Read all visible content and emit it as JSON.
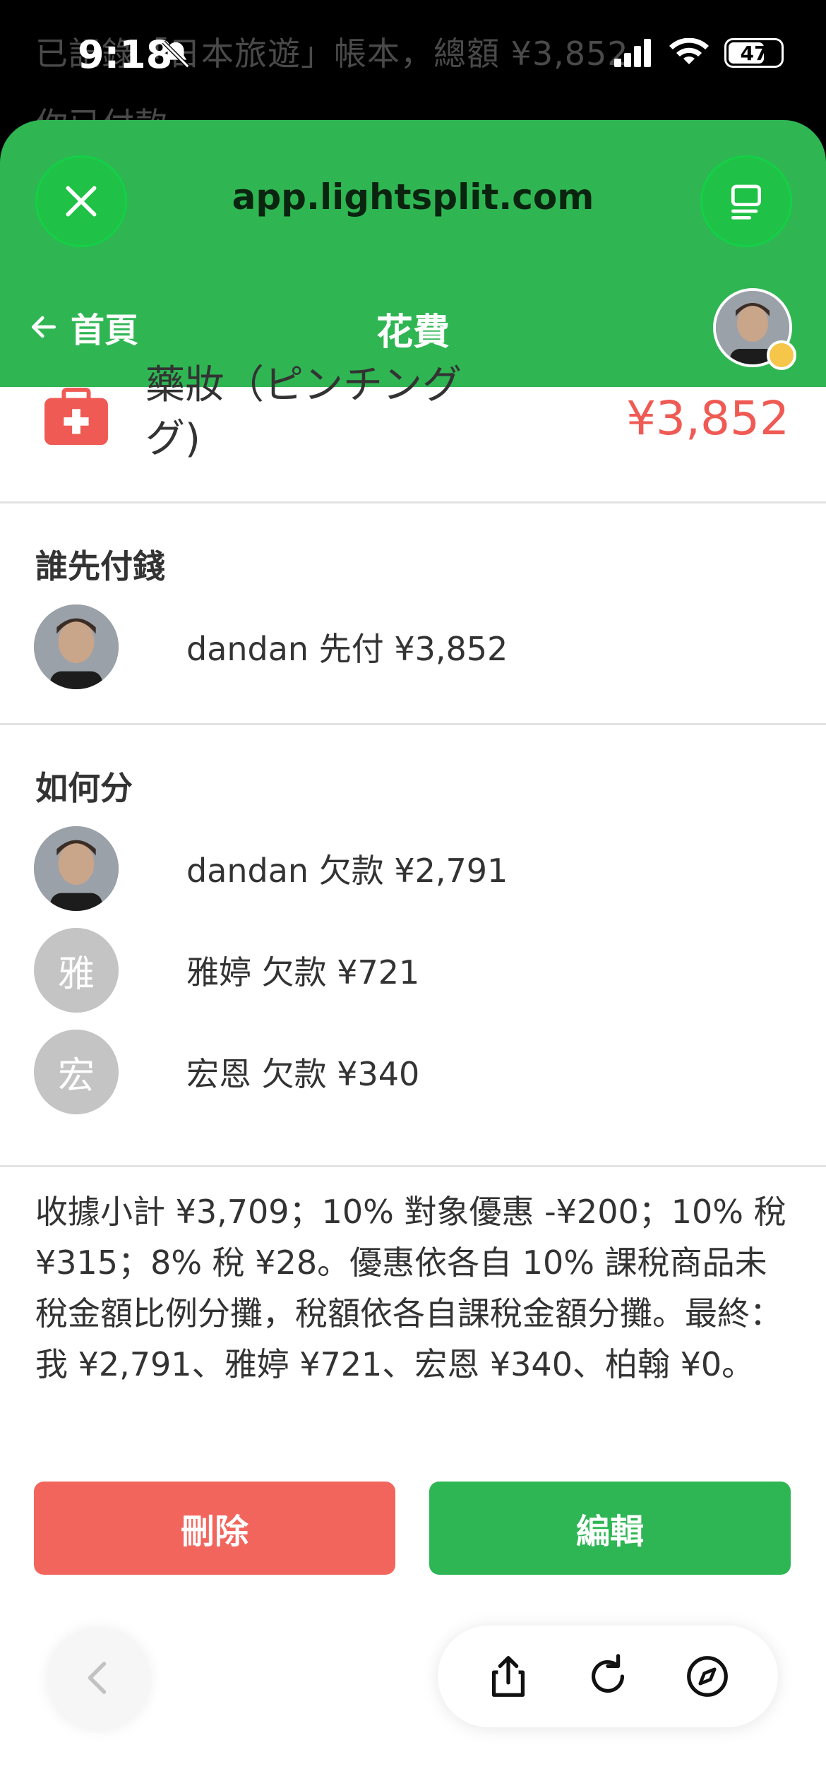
{
  "status_bar": {
    "time": "9:18",
    "battery": "47",
    "notification_line1": "已記錄「日本旅遊」帳本，總額 ¥3,852",
    "notification_line2": "你已付款。"
  },
  "browser": {
    "url": "app.lightsplit.com"
  },
  "nav": {
    "back_label": "首頁",
    "title": "花費"
  },
  "expense": {
    "name_line1": "藥妝（ピンチング",
    "name_line2": "グ)",
    "amount": "¥3,852"
  },
  "payer_section": {
    "title": "誰先付錢",
    "rows": [
      {
        "text": "dandan 先付 ¥3,852"
      }
    ]
  },
  "split_section": {
    "title": "如何分",
    "rows": [
      {
        "avatar_letter": "",
        "text": "dandan 欠款 ¥2,791"
      },
      {
        "avatar_letter": "雅",
        "text": "雅婷 欠款 ¥721"
      },
      {
        "avatar_letter": "宏",
        "text": "宏恩 欠款 ¥340"
      }
    ]
  },
  "summary": "收據小計 ¥3,709；10% 對象優惠 -¥200；10% 稅 ¥315；8% 稅 ¥28。優惠依各自 10% 課稅商品未稅金額比例分攤，稅額依各自課稅金額分攤。最終：我 ¥2,791、雅婷 ¥721、宏恩 ¥340、柏翰 ¥0。",
  "actions": {
    "delete_label": "刪除",
    "edit_label": "編輯"
  },
  "colors": {
    "brand_green": "#2fb653",
    "amount_red": "#ef5a54",
    "delete_red": "#f2655d"
  },
  "icons": [
    "close-icon",
    "tabs-icon",
    "arrow-left-icon",
    "medical-bag-icon",
    "chevron-left-icon",
    "share-icon",
    "reload-icon",
    "compass-icon"
  ]
}
